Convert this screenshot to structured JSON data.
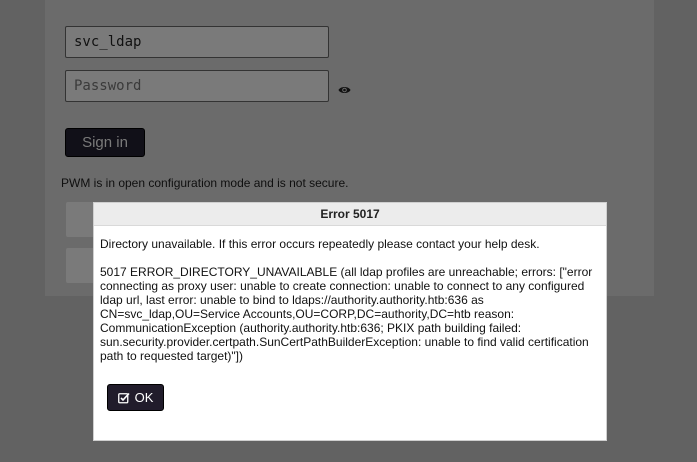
{
  "login": {
    "username_value": "svc_ldap",
    "password_placeholder": "Password",
    "signin_label": "Sign in",
    "config_warning": "PWM is in open configuration mode and is not secure."
  },
  "icons": {
    "reveal_password": "eye-icon",
    "ok": "check-square-icon"
  },
  "dialog": {
    "title": "Error 5017",
    "summary": "Directory unavailable. If this error occurs repeatedly please contact your help desk.",
    "detail": "5017 ERROR_DIRECTORY_UNAVAILABLE (all ldap profiles are unreachable; errors: [\"error connecting as proxy user: unable to create connection: unable to connect to any configured ldap url, last error: unable to bind to ldaps://authority.authority.htb:636 as CN=svc_ldap,OU=Service Accounts,OU=CORP,DC=authority,DC=htb reason: CommunicationException (authority.authority.htb:636; PKIX path building failed: sun.security.provider.certpath.SunCertPathBuilderException: unable to find valid certification path to requested target)\"])",
    "ok_label": "OK"
  }
}
